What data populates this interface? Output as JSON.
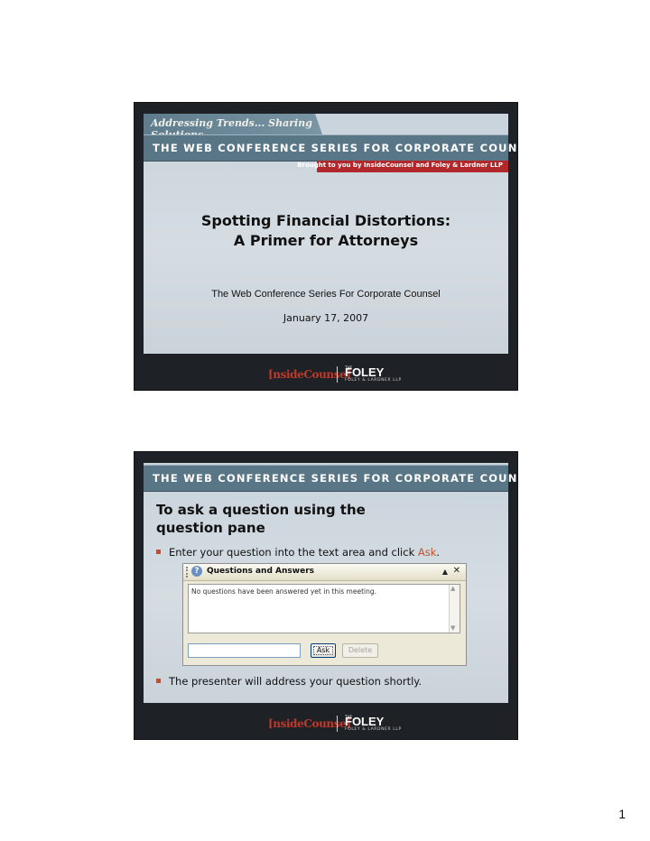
{
  "slide1": {
    "tagline": "Addressing Trends... Sharing Solutions",
    "banner": "THE WEB CONFERENCE SERIES FOR CORPORATE COUNSEL",
    "sponsor": "Brought to you by InsideCounsel and Foley & Lardner LLP",
    "title_line1": "Spotting Financial Distortions:",
    "title_line2": "A Primer for Attorneys",
    "subtitle": "The Web Conference Series For Corporate Counsel",
    "date": "January 17, 2007"
  },
  "slide2": {
    "banner": "THE WEB CONFERENCE SERIES FOR CORPORATE COUNSEL",
    "heading_line1": "To ask a question using the",
    "heading_line2": "question pane",
    "bullet1_prefix": "Enter your question into the text area and click ",
    "bullet1_link": "Ask",
    "bullet1_suffix": ".",
    "bullet2": "The presenter will address your question shortly.",
    "qa_panel": {
      "title": "Questions and Answers",
      "message": "No questions have been answered yet in this meeting.",
      "ask_button": "Ask",
      "delete_button": "Delete"
    }
  },
  "logos": {
    "insidecounsel": "[nsideCounse]",
    "foley": "FOLEY",
    "foley_sub": "FOLEY & LARDNER LLP",
    "foley_the": "THE"
  },
  "page_number": "1",
  "colors": {
    "banner_blue": "#587686",
    "sponsor_red": "#b1272a",
    "accent_orange": "#cc4b25"
  }
}
